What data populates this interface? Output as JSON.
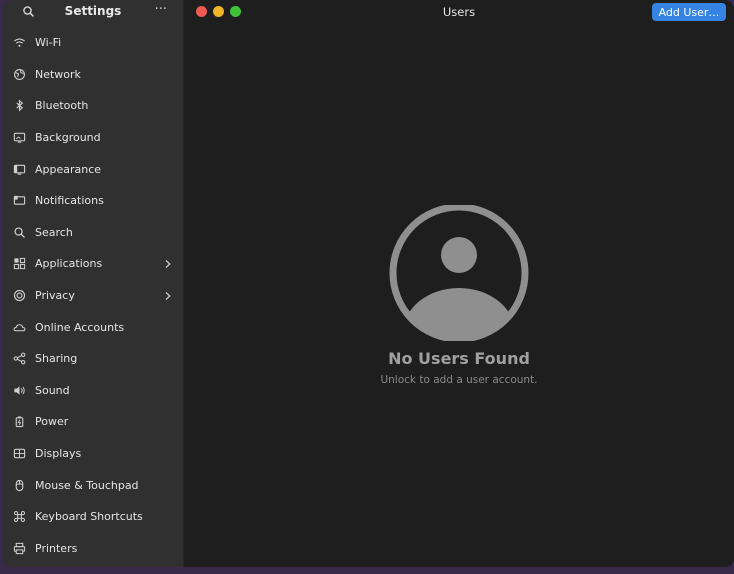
{
  "sidebar": {
    "title": "Settings",
    "menu_label": "···",
    "items": [
      {
        "label": "Wi-Fi",
        "icon": "wifi-icon"
      },
      {
        "label": "Network",
        "icon": "network-icon"
      },
      {
        "label": "Bluetooth",
        "icon": "bluetooth-icon"
      },
      {
        "label": "Background",
        "icon": "background-icon"
      },
      {
        "label": "Appearance",
        "icon": "appearance-icon"
      },
      {
        "label": "Notifications",
        "icon": "notifications-icon"
      },
      {
        "label": "Search",
        "icon": "search-icon"
      },
      {
        "label": "Applications",
        "icon": "applications-icon",
        "has_submenu": true
      },
      {
        "label": "Privacy",
        "icon": "privacy-icon",
        "has_submenu": true
      },
      {
        "label": "Online Accounts",
        "icon": "cloud-icon"
      },
      {
        "label": "Sharing",
        "icon": "share-icon"
      },
      {
        "label": "Sound",
        "icon": "speaker-icon"
      },
      {
        "label": "Power",
        "icon": "battery-icon"
      },
      {
        "label": "Displays",
        "icon": "display-icon"
      },
      {
        "label": "Mouse & Touchpad",
        "icon": "mouse-icon"
      },
      {
        "label": "Keyboard Shortcuts",
        "icon": "keyboard-command-icon"
      },
      {
        "label": "Printers",
        "icon": "printer-icon"
      }
    ]
  },
  "main": {
    "title": "Users",
    "add_user_label": "Add User…",
    "empty_title": "No Users Found",
    "empty_subtitle": "Unlock to add a user account."
  },
  "colors": {
    "accent": "#3584e4",
    "close": "#ee5a52",
    "minimize": "#f0b429",
    "maximize": "#3fc13a"
  }
}
